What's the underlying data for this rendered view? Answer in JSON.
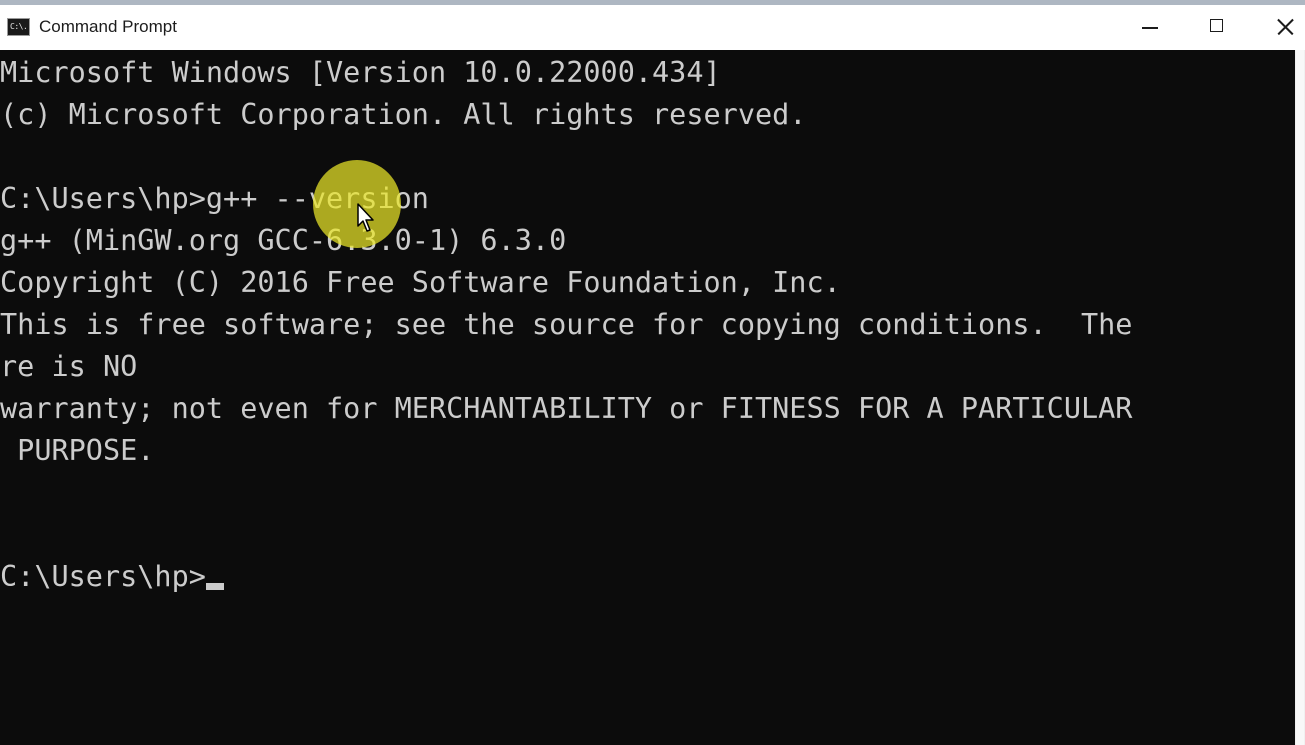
{
  "window": {
    "title": "Command Prompt",
    "icon": "console-icon",
    "icon_glyph": "C:\\.",
    "controls": [
      "minimize-icon",
      "maximize-icon",
      "close-icon"
    ]
  },
  "console": {
    "lines": {
      "l1": "Microsoft Windows [Version 10.0.22000.434]",
      "l2": "(c) Microsoft Corporation. All rights reserved.",
      "l4": "C:\\Users\\hp>g++ --version",
      "l5": "g++ (MinGW.org GCC-6.3.0-1) 6.3.0",
      "l6": "Copyright (C) 2016 Free Software Foundation, Inc.",
      "l7": "This is free software; see the source for copying conditions.  The",
      "l8": "re is NO",
      "l9": "warranty; not even for MERCHANTABILITY or FITNESS FOR A PARTICULAR",
      "l10": " PURPOSE.",
      "l13": "C:\\Users\\hp>"
    }
  },
  "colors": {
    "console_bg": "#0c0c0c",
    "console_text": "#cccccc",
    "titlebar_bg": "#ffffff",
    "cursor_highlight": "#eae628"
  }
}
